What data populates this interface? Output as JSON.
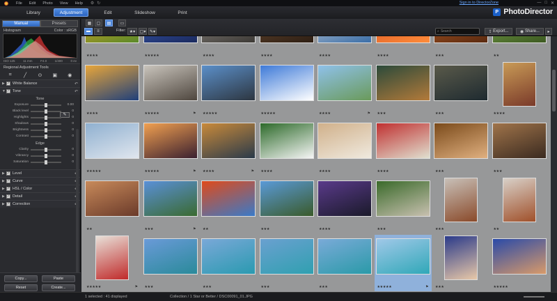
{
  "app": {
    "menu": [
      "File",
      "Edit",
      "Photo",
      "View",
      "Help"
    ],
    "sign_in": "Sign in to DirectorZone",
    "brand": "PhotoDirector"
  },
  "modes": [
    "Library",
    "Adjustment",
    "Edit",
    "Slideshow",
    "Print"
  ],
  "active_mode": "Adjustment",
  "left_panel": {
    "tabs": [
      "Manual",
      "Presets"
    ],
    "histogram_label": "Histogram",
    "color_label": "Color : sRGB",
    "hist_info": [
      "ISO 125",
      "11 mm",
      "F4.0",
      "1/400",
      "0 ev"
    ],
    "regional_title": "Regional Adjustment Tools",
    "sections_top": [
      "White Balance",
      "Tone"
    ],
    "tone_title": "Tone",
    "tone_sliders": [
      {
        "label": "Exposure",
        "value": "0.00"
      },
      {
        "label": "Black level",
        "value": "0"
      },
      {
        "label": "Highlights",
        "value": "0"
      },
      {
        "label": "Shadows",
        "value": "0"
      },
      {
        "label": "Brightness",
        "value": "0"
      },
      {
        "label": "Contrast",
        "value": "0"
      }
    ],
    "edge_title": "Edge",
    "edge_sliders": [
      {
        "label": "Clarity",
        "value": "0"
      },
      {
        "label": "Vibrancy",
        "value": "0"
      },
      {
        "label": "Saturation",
        "value": "0"
      }
    ],
    "sections_bottom": [
      "Level",
      "Curve",
      "HSL / Color",
      "Detail",
      "Correction"
    ],
    "buttons": {
      "copy": "Copy...",
      "paste": "Paste",
      "reset": "Reset",
      "create": "Create..."
    }
  },
  "toolbar": {
    "filter": "Filter:",
    "search_placeholder": "Search",
    "export": "Export...",
    "share": "Share..."
  },
  "thumbnails": [
    {
      "stars": "★★★★",
      "colors": [
        "#e0a020",
        "#5a8a2a"
      ],
      "flag": ""
    },
    {
      "stars": "★★★★★",
      "colors": [
        "#3a5db8",
        "#1b2a5e"
      ],
      "flag": ""
    },
    {
      "stars": "★★★★",
      "colors": [
        "#8f8a84",
        "#3d3a36"
      ],
      "flag": ""
    },
    {
      "stars": "★★★★",
      "colors": [
        "#6a4a30",
        "#2e1f14"
      ],
      "flag": ""
    },
    {
      "stars": "★★★★",
      "colors": [
        "#c8ced6",
        "#3a6ea8"
      ],
      "flag": ""
    },
    {
      "stars": "★★★★",
      "colors": [
        "#d04a1e",
        "#ff8c3a"
      ],
      "flag": ""
    },
    {
      "stars": "★★★",
      "colors": [
        "#b35b23",
        "#5a2a10"
      ],
      "flag": ""
    },
    {
      "stars": "★★",
      "colors": [
        "#7aa54a",
        "#3d5a22"
      ],
      "flag": ""
    },
    {
      "stars": "★★★★",
      "colors": [
        "#e8a63a",
        "#1f3f7a"
      ],
      "flag": ""
    },
    {
      "stars": "★★★★★",
      "colors": [
        "#c9c4bc",
        "#4e463e"
      ],
      "flag": "⚑"
    },
    {
      "stars": "★★★★★",
      "colors": [
        "#5b8fc9",
        "#2d3640"
      ],
      "flag": ""
    },
    {
      "stars": "★★★★★",
      "colors": [
        "#3e7ad8",
        "#ffffff"
      ],
      "flag": ""
    },
    {
      "stars": "★★★★",
      "colors": [
        "#8fc1ea",
        "#6a9a5a"
      ],
      "flag": "⚑"
    },
    {
      "stars": "★★★",
      "colors": [
        "#2b4a3a",
        "#b37a3a"
      ],
      "flag": ""
    },
    {
      "stars": "★★★",
      "colors": [
        "#5a5a4a",
        "#1e2a30"
      ],
      "flag": ""
    },
    {
      "stars": "★★★★",
      "colors": [
        "#c89a56",
        "#7a3a2a"
      ],
      "flag": ""
    },
    {
      "stars": "★★★★★",
      "colors": [
        "#8fb0d0",
        "#e0e6ee"
      ],
      "flag": ""
    },
    {
      "stars": "★★★★★",
      "colors": [
        "#f1a050",
        "#3a2030"
      ],
      "flag": "⚑"
    },
    {
      "stars": "★★★★",
      "colors": [
        "#c98a3a",
        "#2a3a4a"
      ],
      "flag": "⚑"
    },
    {
      "stars": "★★★★",
      "colors": [
        "#2d6a2a",
        "#f5f5f5"
      ],
      "flag": ""
    },
    {
      "stars": "★★★★",
      "colors": [
        "#d0b08a",
        "#f0eadf"
      ],
      "flag": ""
    },
    {
      "stars": "★★★★",
      "colors": [
        "#c03030",
        "#e0e0d0"
      ],
      "flag": ""
    },
    {
      "stars": "★★★",
      "colors": [
        "#7a4a1a",
        "#e0b080"
      ],
      "flag": ""
    },
    {
      "stars": "★★★",
      "colors": [
        "#a0744a",
        "#3a2a20"
      ],
      "flag": ""
    },
    {
      "stars": "★★",
      "colors": [
        "#c88a5a",
        "#6a3a2a"
      ],
      "flag": ""
    },
    {
      "stars": "★★★",
      "colors": [
        "#5a90d8",
        "#3a6a30"
      ],
      "flag": "⚑"
    },
    {
      "stars": "★★",
      "colors": [
        "#e04a1a",
        "#3a7ac8"
      ],
      "flag": ""
    },
    {
      "stars": "★★★",
      "colors": [
        "#5a9ad8",
        "#3a5a2a"
      ],
      "flag": ""
    },
    {
      "stars": "★★★★",
      "colors": [
        "#5a3a8a",
        "#1a1a2a"
      ],
      "flag": ""
    },
    {
      "stars": "★★★",
      "colors": [
        "#3a6a2a",
        "#c8c0b0"
      ],
      "flag": ""
    },
    {
      "stars": "★★★",
      "colors": [
        "#c8c0b8",
        "#8a4a2a"
      ],
      "flag": ""
    },
    {
      "stars": "★★",
      "colors": [
        "#d8d0c8",
        "#a0502a"
      ],
      "flag": ""
    },
    {
      "stars": "★★★★★",
      "colors": [
        "#e8e0d8",
        "#c02a2a"
      ],
      "flag": "⚑"
    },
    {
      "stars": "★★★",
      "colors": [
        "#6a9ad8",
        "#2a8a9a"
      ],
      "flag": ""
    },
    {
      "stars": "★★★",
      "colors": [
        "#7aa8d8",
        "#2a9ab0"
      ],
      "flag": ""
    },
    {
      "stars": "★★★",
      "colors": [
        "#6aa0d0",
        "#30a0b0"
      ],
      "flag": ""
    },
    {
      "stars": "★★★",
      "colors": [
        "#7aaad8",
        "#2a9aa8"
      ],
      "flag": ""
    },
    {
      "stars": "★★★★★",
      "colors": [
        "#a0c8e8",
        "#30a8b8"
      ],
      "flag": "⚑"
    },
    {
      "stars": "★★★",
      "colors": [
        "#2a3a8a",
        "#e8c8a8"
      ],
      "flag": ""
    },
    {
      "stars": "★★★★★",
      "colors": [
        "#2a4aa8",
        "#d89a6a"
      ],
      "flag": ""
    }
  ],
  "status": {
    "selected": "1 selected : 41 displayed",
    "collection": "Collection / 1 Star or Better / DSC00091_01.JPG"
  }
}
